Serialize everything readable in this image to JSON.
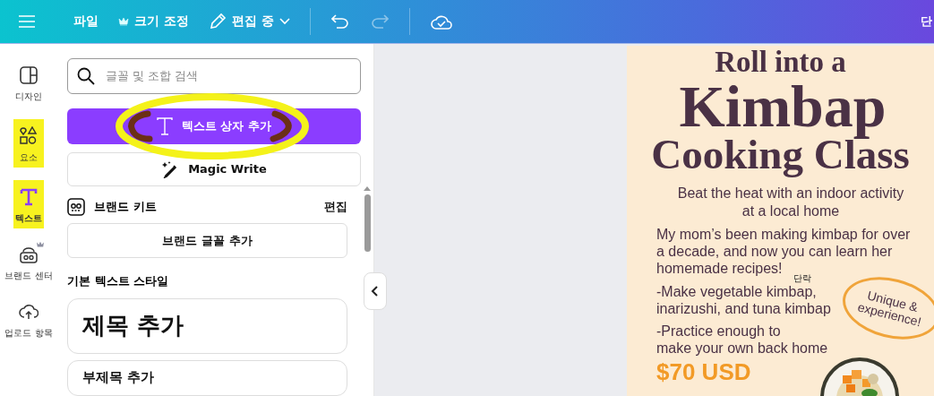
{
  "topbar": {
    "items": [
      {
        "kind": "menu"
      },
      {
        "kind": "label",
        "label": "파일"
      },
      {
        "kind": "premium",
        "label": "크기 조정"
      },
      {
        "kind": "dropdown",
        "label": "편집 중"
      },
      {
        "kind": "undo",
        "disabled": false
      },
      {
        "kind": "redo",
        "disabled": true
      },
      {
        "kind": "cloud"
      }
    ],
    "cut_text": "단"
  },
  "sidebar": {
    "items": [
      {
        "kind": "design",
        "label": "디자인",
        "selected": false,
        "highlighted": false
      },
      {
        "kind": "elements",
        "label": "요소",
        "selected": false,
        "highlighted": true
      },
      {
        "kind": "text",
        "label": "텍스트",
        "selected": true,
        "highlighted": true
      },
      {
        "kind": "brand",
        "label": "브랜드 센터",
        "selected": false,
        "highlighted": false
      },
      {
        "kind": "upload",
        "label": "업로드 항목",
        "selected": false,
        "highlighted": false
      }
    ]
  },
  "panel": {
    "search": {
      "placeholder": "글꼴 및 조합 검색"
    },
    "primary_button": {
      "label": "텍스트 상자 추가",
      "circled": true
    },
    "magic_button": {
      "label": "Magic Write"
    },
    "brand_kit": {
      "title": "브랜드 키트",
      "action": "편집"
    },
    "brand_font_button": {
      "label": "브랜드 글꼴 추가"
    },
    "section_title": "기본 텍스트 스타일",
    "styles": [
      {
        "kind": "heading",
        "label": "제목 추가"
      },
      {
        "kind": "subheading",
        "label": "부제목 추가"
      }
    ]
  },
  "poster": {
    "title_lines": [
      "Roll into a",
      "Kimbap",
      "Cooking Class"
    ],
    "subtitle": [
      "Beat the heat with an indoor activity",
      "at a local home"
    ],
    "intro": [
      "My mom’s been making kimbap for over",
      "a decade, and now you can learn her",
      "homemade recipes!"
    ],
    "tooltip": "단락",
    "bullets": [
      [
        "-Make vegetable kimbap,",
        "inarizushi, and tuna kimbap"
      ],
      [
        "-Practice enough to",
        "make your own back home"
      ]
    ],
    "bubble": [
      "Unique &",
      "experience!"
    ],
    "price": "$70 USD"
  }
}
